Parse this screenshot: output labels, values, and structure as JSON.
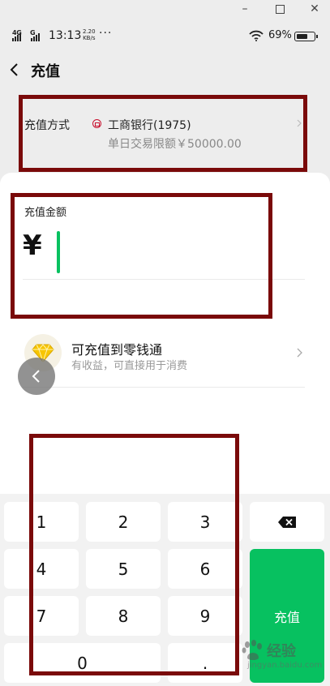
{
  "window": {
    "min_glyph": "–",
    "close_glyph": "✕"
  },
  "status": {
    "network": "4G",
    "network2": "G",
    "time": "13:13",
    "speed_value": "2.20",
    "speed_unit": "KB/s",
    "more": "···",
    "battery": "69%",
    "battery_level": 0.69
  },
  "header": {
    "title": "充值"
  },
  "method": {
    "label": "充值方式",
    "bank": "工商银行(1975)",
    "limit": "单日交易限额￥50000.00"
  },
  "amount": {
    "label": "充值金额",
    "currency": "¥"
  },
  "lingqiantong": {
    "title": "可充值到零钱通",
    "subtitle": "有收益，可直接用于消费"
  },
  "keypad": {
    "keys": [
      "1",
      "2",
      "3",
      "4",
      "5",
      "6",
      "7",
      "8",
      "9",
      "0",
      "."
    ],
    "confirm": "充值"
  },
  "watermark": {
    "brand": "经验",
    "url": "jingyan.baidu.com"
  },
  "colors": {
    "accent": "#07c160",
    "annotation": "#7a0a0a",
    "bank": "#c8102e"
  }
}
